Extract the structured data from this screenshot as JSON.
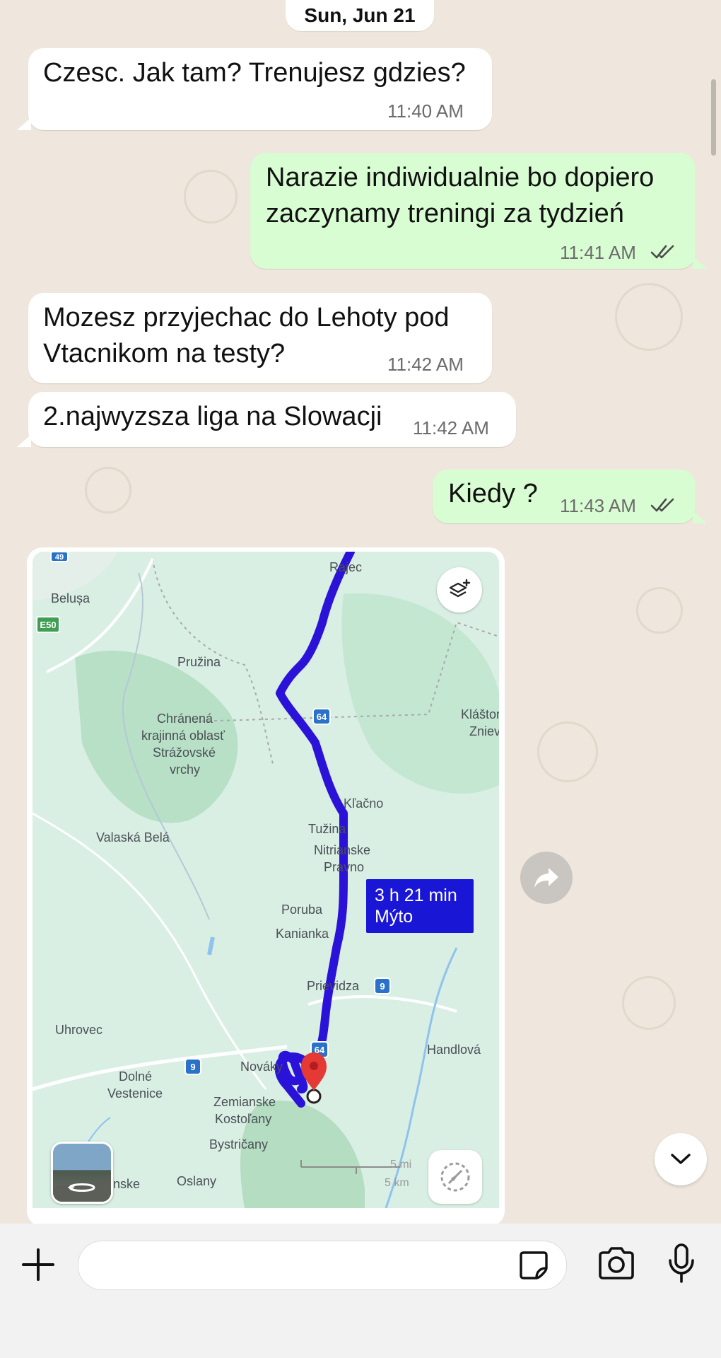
{
  "date_separator": "Sun, Jun 21",
  "messages": [
    {
      "direction": "incoming",
      "text": "Czesc. Jak tam? Trenujesz gdzies?",
      "time": "11:40 AM"
    },
    {
      "direction": "outgoing",
      "text_line1": "Narazie indiwidualnie bo dopiero",
      "text_line2": "zaczynamy treningi za tydzień",
      "time": "11:41 AM",
      "status": "read"
    },
    {
      "direction": "incoming",
      "text_line1": "Mozesz przyjechac do Lehoty pod",
      "text_line2": "Vtacnikom na testy?",
      "time": "11:42 AM"
    },
    {
      "direction": "incoming",
      "text": "2.najwyzsza liga na Slowacji",
      "time": "11:42 AM"
    },
    {
      "direction": "outgoing",
      "text": "Kiedy ?",
      "time": "11:43 AM",
      "status": "read"
    }
  ],
  "map": {
    "route_duration": "3 h 21 min",
    "route_via": "Mýto",
    "places": [
      "Rajec",
      "Belușa",
      "Pružina",
      "Chránená",
      "krajinná oblasť",
      "Strážovské",
      "vrchy",
      "Kláštor",
      "Zniev",
      "Kľačno",
      "Tužina",
      "Nitrianske",
      "Pravno",
      "Valaská Belá",
      "Poruba",
      "Kanianka",
      "Prievidza",
      "Uhrovec",
      "Handlová",
      "Nováky",
      "Dolné",
      "Vestenice",
      "Zemianske",
      "Kostoľany",
      "Bystričany",
      "Oslany",
      "anske"
    ],
    "road_shields": [
      "E50",
      "64",
      "64",
      "9",
      "9",
      "64",
      "49"
    ],
    "scale_label_1": "5 mi",
    "scale_label_2": "5 km",
    "colors": {
      "route": "#2b12d8",
      "water": "#8fc3ee",
      "land": "#d8efe3",
      "forest": "#b6e0c5",
      "pin": "#e53935"
    }
  },
  "icons": {
    "layers": "layers-icon",
    "recenter": "compass-icon",
    "streetview": "street-view-thumbnail",
    "forward": "forward-arrow-icon",
    "scroll": "chevron-down-icon",
    "plus": "plus-icon",
    "sticker": "sticker-icon",
    "camera": "camera-icon",
    "mic": "microphone-icon"
  }
}
